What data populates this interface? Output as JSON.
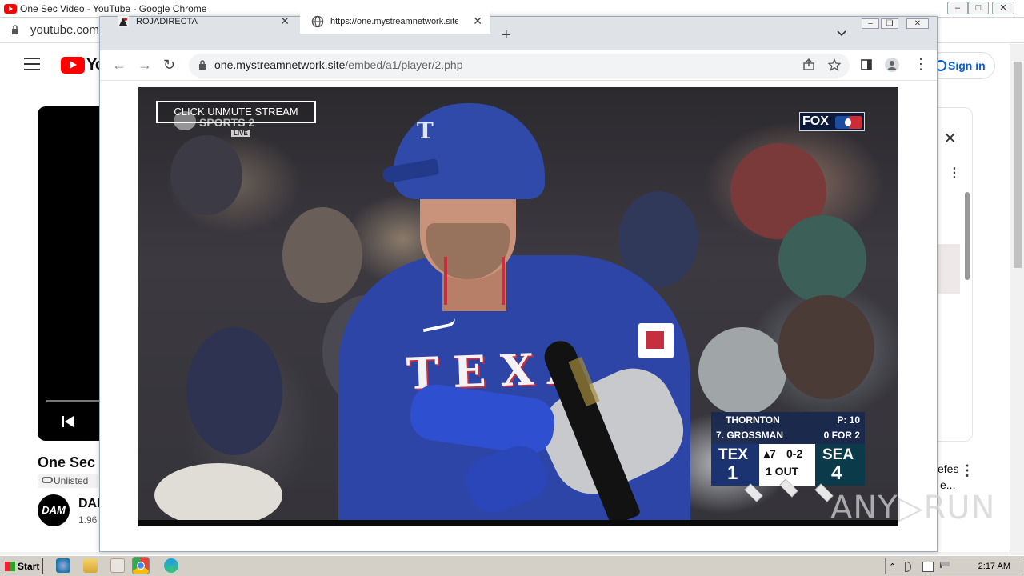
{
  "background_window": {
    "title": "One Sec Video - YouTube - Google Chrome",
    "address": "youtube.com/",
    "signin_label": "Sign in",
    "video_title": "One Sec",
    "unlisted_label": "Unlisted",
    "channel_avatar_text": "DAM",
    "channel_name": "DAI",
    "channel_subs": "1.96",
    "rec_title_line1": "efes",
    "rec_title_line2": "e..."
  },
  "front_window": {
    "tabs": [
      {
        "label": "ROJADIRECTA",
        "active": false
      },
      {
        "label": "https://one.mystreamnetwork.site/e",
        "active": true
      }
    ],
    "url_host": "one.mystreamnetwork.site",
    "url_path": "/embed/a1/player/2.php"
  },
  "player": {
    "unmute_label": "CLICK UNMUTE STREAM",
    "watermark_text": "SPORTS 2",
    "watermark_live": "LIVE",
    "broadcast_logo": "FOX",
    "jersey_text": "TEXA",
    "helmet_letter": "T",
    "scorebug": {
      "pitcher": "THORNTON",
      "pitch_count": "P: 10",
      "batter": "7. GROSSMAN",
      "batter_line": "0 FOR 2",
      "away_team": "TEX",
      "away_score": "1",
      "home_team": "SEA",
      "home_score": "4",
      "inning": "▴7",
      "count": "0-2",
      "outs": "1 OUT"
    }
  },
  "watermark": "ANY▷RUN",
  "taskbar": {
    "start_label": "Start",
    "clock": "2:17 AM"
  },
  "colors": {
    "jersey_blue": "#2d45a6",
    "youtube_red": "#ff0000",
    "link_blue": "#065fd4"
  }
}
